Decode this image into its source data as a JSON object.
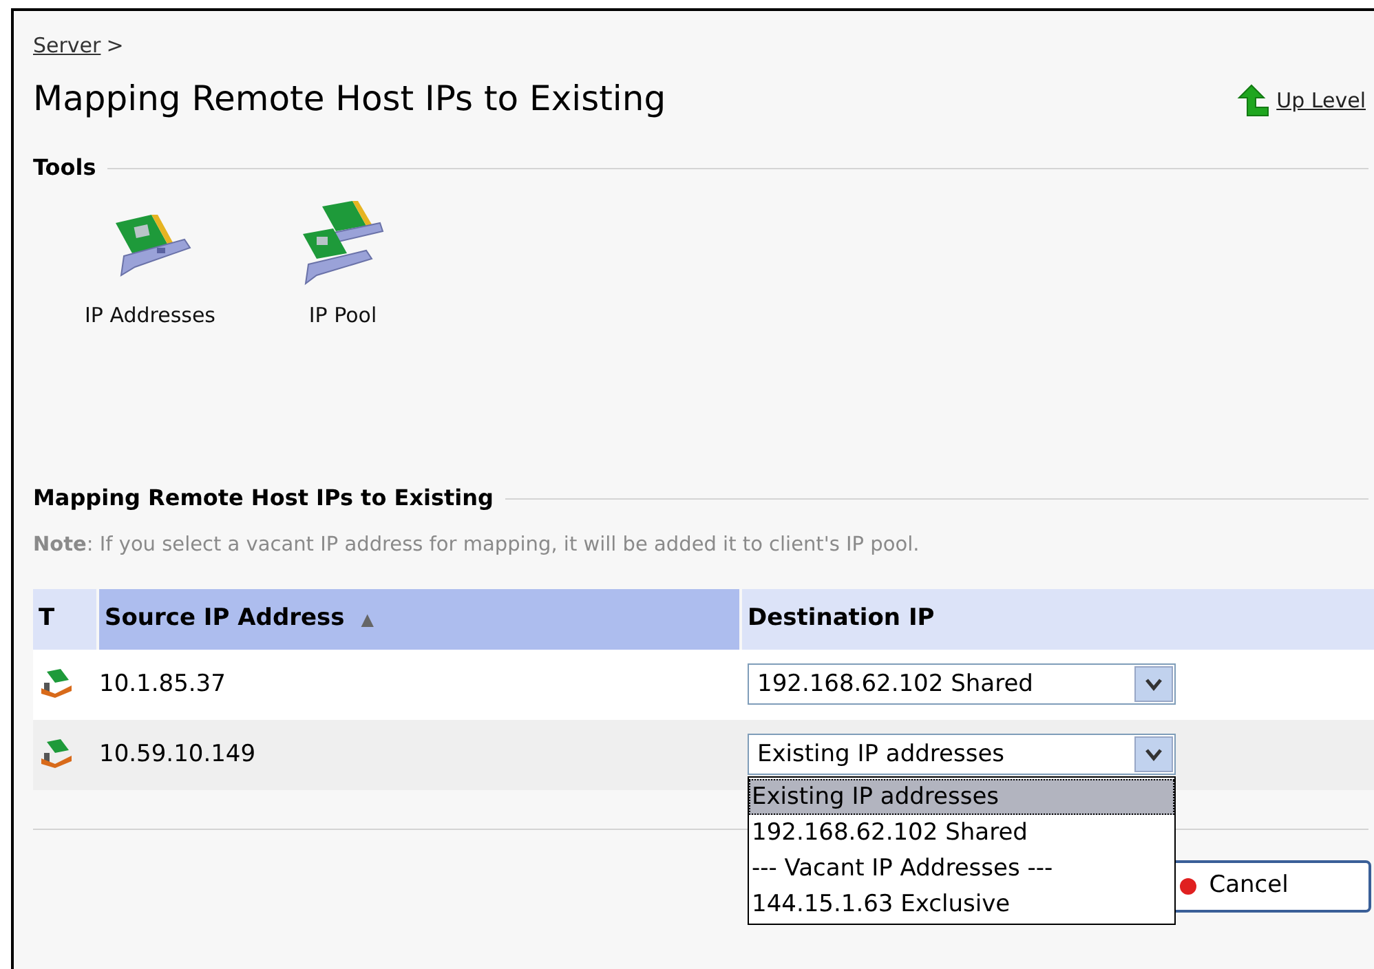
{
  "breadcrumb": {
    "link": "Server",
    "separator": ">"
  },
  "title": "Mapping Remote Host IPs to Existing",
  "up_level": "Up Level",
  "tools": {
    "heading": "Tools",
    "items": [
      {
        "label": "IP Addresses",
        "kind": "single"
      },
      {
        "label": "IP Pool",
        "kind": "pool"
      }
    ]
  },
  "mapping": {
    "heading": "Mapping Remote Host IPs to Existing",
    "note": "**Note**: If you select a vacant IP address for mapping, it will be added it to client's IP pool.",
    "table": {
      "columns": [
        {
          "label": "T",
          "sorted": false
        },
        {
          "label": "Source IP Address",
          "sorted": true,
          "sort_mark": "▲"
        },
        {
          "label": "Destination IP",
          "sorted": false
        }
      ],
      "rows": [
        {
          "source": "10.1.85.37",
          "destination": "192.168.62.102 Shared"
        },
        {
          "source": "10.59.10.149",
          "destination": "Existing IP addresses",
          "options": [
            {
              "label": "Existing IP addresses",
              "selected": true
            },
            {
              "label": "192.168.62.102 Shared",
              "selected": false
            },
            {
              "label": "--- Vacant IP Addresses ---",
              "selected": false
            },
            {
              "label": "144.15.1.63 Exclusive",
              "selected": false
            }
          ]
        }
      ]
    }
  },
  "buttons": [
    {
      "label": "Cancel"
    }
  ]
}
